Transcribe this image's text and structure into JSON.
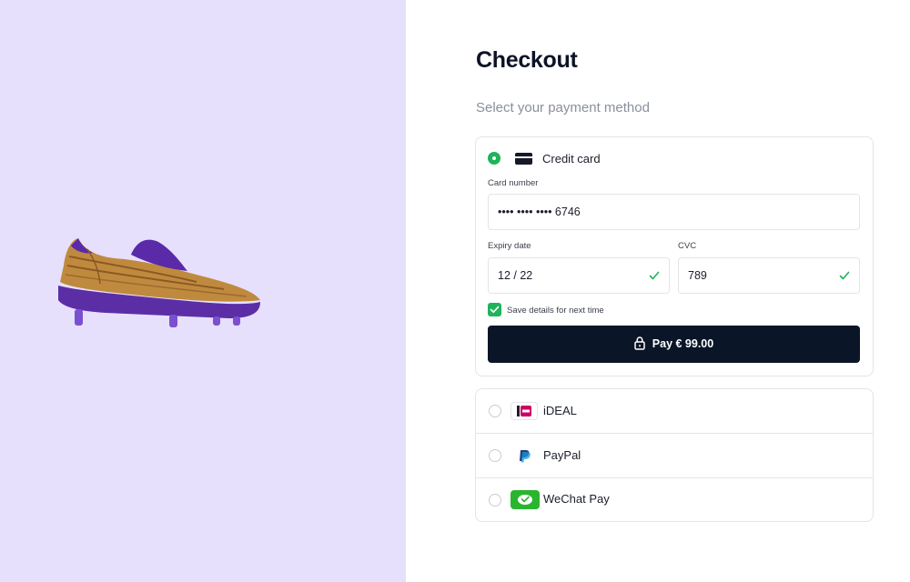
{
  "product": {
    "image_icon": "football-boot-image"
  },
  "checkout": {
    "title": "Checkout",
    "subtitle": "Select your payment method"
  },
  "credit_card": {
    "label": "Credit card",
    "icon": "credit-card-icon",
    "selected": true,
    "card_number_label": "Card number",
    "card_number_value": "•••• •••• •••• 6746",
    "expiry_label": "Expiry date",
    "expiry_value": "12 / 22",
    "cvc_label": "CVC",
    "cvc_value": "789",
    "save_details_label": "Save details for next time",
    "save_details_checked": true,
    "pay_button_label": "Pay € 99.00"
  },
  "other_methods": [
    {
      "label": "iDEAL",
      "icon": "ideal-logo-icon",
      "selected": false
    },
    {
      "label": "PayPal",
      "icon": "paypal-logo-icon",
      "selected": false
    },
    {
      "label": "WeChat Pay",
      "icon": "wechat-pay-logo-icon",
      "selected": false
    }
  ],
  "colors": {
    "left_panel_bg": "#e6e0fd",
    "accent_green": "#1fb35b",
    "pay_button_bg": "#0b1528",
    "heading": "#0d1326"
  }
}
